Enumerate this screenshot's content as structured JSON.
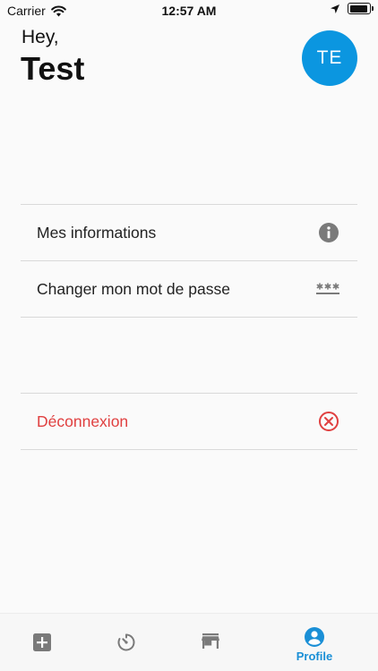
{
  "status_bar": {
    "carrier": "Carrier",
    "time": "12:57 AM",
    "battery_level": 0.95
  },
  "header": {
    "greeting": "Hey,",
    "name": "Test",
    "avatar_initials": "TE"
  },
  "menu": {
    "items": [
      {
        "label": "Mes informations",
        "icon": "info-icon"
      },
      {
        "label": "Changer mon mot de passe",
        "icon": "password-icon"
      }
    ],
    "logout": {
      "label": "Déconnexion",
      "icon": "close-circle-icon"
    }
  },
  "tab_bar": {
    "tabs": [
      {
        "icon": "add-box-icon",
        "label": ""
      },
      {
        "icon": "timer-icon",
        "label": ""
      },
      {
        "icon": "store-icon",
        "label": ""
      },
      {
        "icon": "profile-icon",
        "label": "Profile",
        "active": true
      }
    ]
  },
  "colors": {
    "accent": "#0b96e0",
    "danger": "#e04040",
    "icon_gray": "#7a7a7a",
    "tab_active": "#1a8fd6"
  }
}
